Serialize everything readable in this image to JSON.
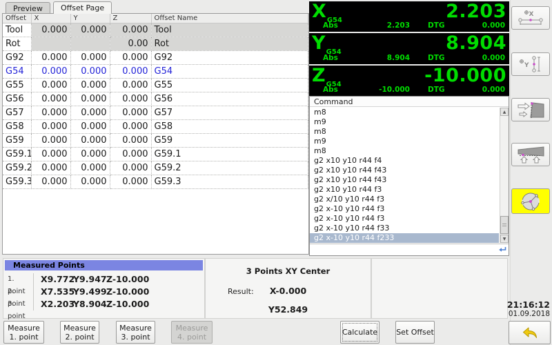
{
  "tabs": [
    {
      "label": "Preview",
      "active": false
    },
    {
      "label": "Offset Page",
      "active": true
    }
  ],
  "offset_table": {
    "columns": [
      "Offset",
      "X",
      "Y",
      "Z",
      "Offset Name"
    ],
    "rows": [
      {
        "offset": "Tool",
        "x": "0.000",
        "y": "0.000",
        "z": "0.000",
        "name": "Tool",
        "style": "gray"
      },
      {
        "offset": "Rot",
        "x": "",
        "y": "",
        "z": "0.00",
        "name": "Rot",
        "style": "gray"
      },
      {
        "offset": "G92",
        "x": "0.000",
        "y": "0.000",
        "z": "0.000",
        "name": "G92",
        "style": ""
      },
      {
        "offset": "G54",
        "x": "0.000",
        "y": "0.000",
        "z": "0.000",
        "name": "G54",
        "style": "blue"
      },
      {
        "offset": "G55",
        "x": "0.000",
        "y": "0.000",
        "z": "0.000",
        "name": "G55",
        "style": ""
      },
      {
        "offset": "G56",
        "x": "0.000",
        "y": "0.000",
        "z": "0.000",
        "name": "G56",
        "style": ""
      },
      {
        "offset": "G57",
        "x": "0.000",
        "y": "0.000",
        "z": "0.000",
        "name": "G57",
        "style": ""
      },
      {
        "offset": "G58",
        "x": "0.000",
        "y": "0.000",
        "z": "0.000",
        "name": "G58",
        "style": ""
      },
      {
        "offset": "G59",
        "x": "0.000",
        "y": "0.000",
        "z": "0.000",
        "name": "G59",
        "style": ""
      },
      {
        "offset": "G59.1",
        "x": "0.000",
        "y": "0.000",
        "z": "0.000",
        "name": "G59.1",
        "style": ""
      },
      {
        "offset": "G59.2",
        "x": "0.000",
        "y": "0.000",
        "z": "0.000",
        "name": "G59.2",
        "style": ""
      },
      {
        "offset": "G59.3",
        "x": "0.000",
        "y": "0.000",
        "z": "0.000",
        "name": "G59.3",
        "style": ""
      }
    ]
  },
  "dro": {
    "axes": [
      {
        "letter": "X",
        "system": "G54",
        "value": "2.203",
        "abs_label": "Abs",
        "abs": "2.203",
        "dtg_label": "DTG",
        "dtg": "0.000"
      },
      {
        "letter": "Y",
        "system": "G54",
        "value": "8.904",
        "abs_label": "Abs",
        "abs": "8.904",
        "dtg_label": "DTG",
        "dtg": "0.000"
      },
      {
        "letter": "Z",
        "system": "G54",
        "value": "-10.000",
        "abs_label": "Abs",
        "abs": "-10.000",
        "dtg_label": "DTG",
        "dtg": "0.000"
      }
    ]
  },
  "command_panel": {
    "header": "Command",
    "entries": [
      "m8",
      "m9",
      "m8",
      "m9",
      "m8",
      "g2 x10 y10 r44 f4",
      "g2 x10 y10 r44 f43",
      "g2 x10 y10 r44 f43",
      "g2 x10 y10 r44 f3",
      "g2 x/10 y10 r44 f3",
      "g2 x-10 y10 r44 f3",
      "g2 x-10 y10 r44 f3",
      "g2 x-10 y10 r44 f33",
      "g2 x-10 y10 r44 f233"
    ],
    "selected_index": 13,
    "input_value": ""
  },
  "side_toolbar": [
    {
      "icon": "measure-tool-x-icon",
      "active": false
    },
    {
      "icon": "measure-tool-y-icon",
      "active": false
    },
    {
      "icon": "measure-edge-x-icon",
      "active": false
    },
    {
      "icon": "measure-edge-y-icon",
      "active": false
    },
    {
      "icon": "measure-circle-3point-icon",
      "active": true
    }
  ],
  "measured_points": {
    "title": "Measured Points",
    "points": [
      {
        "label": "1. point",
        "x": "X9.772",
        "y": "Y9.947",
        "z": "Z-10.000"
      },
      {
        "label": "2. point",
        "x": "X7.535",
        "y": "Y9.499",
        "z": "Z-10.000"
      },
      {
        "label": "3. point",
        "x": "X2.203",
        "y": "Y8.904",
        "z": "Z-10.000"
      }
    ]
  },
  "result_panel": {
    "title": "3 Points XY Center",
    "result_label": "Result:",
    "x": "X-0.000",
    "y": "Y52.849"
  },
  "clock": {
    "time": "21:16:12",
    "date": "01.09.2018"
  },
  "bottom_buttons": {
    "measure": [
      {
        "line1": "Measure",
        "line2": "1. point",
        "enabled": true
      },
      {
        "line1": "Measure",
        "line2": "2. point",
        "enabled": true
      },
      {
        "line1": "Measure",
        "line2": "3. point",
        "enabled": true
      },
      {
        "line1": "Measure",
        "line2": "4. point",
        "enabled": false
      }
    ],
    "calculate_label": "Calculate",
    "set_offset_label": "Set Offset"
  },
  "colors": {
    "dro_background": "#000000",
    "dro_green": "#00dd00",
    "selected_row": "#a8b8ce",
    "active_button_yellow": "#ffff00",
    "measured_header_blue": "#7b85e2",
    "g54_row_blue": "#2323d8"
  }
}
